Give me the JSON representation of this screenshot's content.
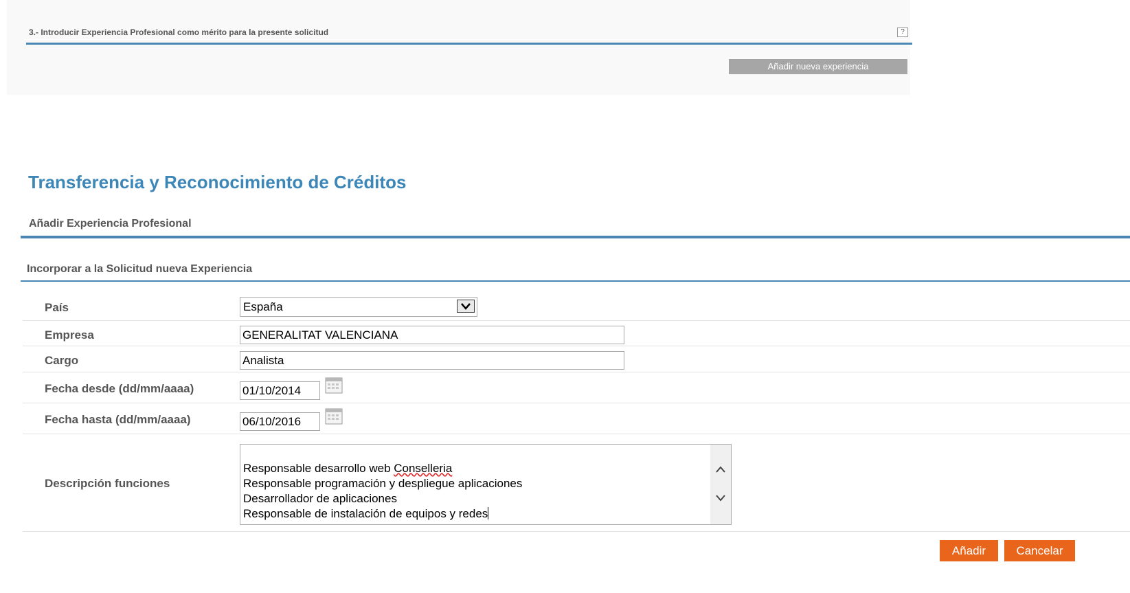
{
  "step_section": {
    "title": "3.- Introducir Experiencia Profesional como mérito para la presente solicitud",
    "help_label": "?",
    "add_button_label": "Añadir nueva experiencia"
  },
  "page": {
    "title": "Transferencia y Reconocimiento de Créditos",
    "section_title": "Añadir Experiencia Profesional",
    "subsection_title": "Incorporar a la Solicitud nueva Experiencia"
  },
  "form": {
    "pais": {
      "label": "País",
      "value": "España"
    },
    "empresa": {
      "label": "Empresa",
      "value": "GENERALITAT VALENCIANA"
    },
    "cargo": {
      "label": "Cargo",
      "value": "Analista"
    },
    "fecha_desde": {
      "label": "Fecha desde (dd/mm/aaaa)",
      "value": "01/10/2014"
    },
    "fecha_hasta": {
      "label": "Fecha hasta (dd/mm/aaaa)",
      "value": "06/10/2016"
    },
    "descripcion": {
      "label": "Descripción funciones",
      "lines": [
        "Responsable desarrollo web ",
        "Conselleria",
        "Responsable programación y despliegue aplicaciones",
        "Desarrollador de aplicaciones",
        "Responsable de instalación de equipos y redes"
      ]
    }
  },
  "actions": {
    "add_label": "Añadir",
    "cancel_label": "Cancelar"
  },
  "colors": {
    "accent_blue": "#4a86b4",
    "title_blue": "#3d87b8",
    "button_orange": "#e8651b",
    "button_grey": "#a6a6a6"
  },
  "icons": {
    "help": "help-icon",
    "select_arrow": "chevron-down-icon",
    "calendar": "calendar-icon",
    "scroll_up": "chevron-up-icon",
    "scroll_down": "chevron-down-icon"
  }
}
